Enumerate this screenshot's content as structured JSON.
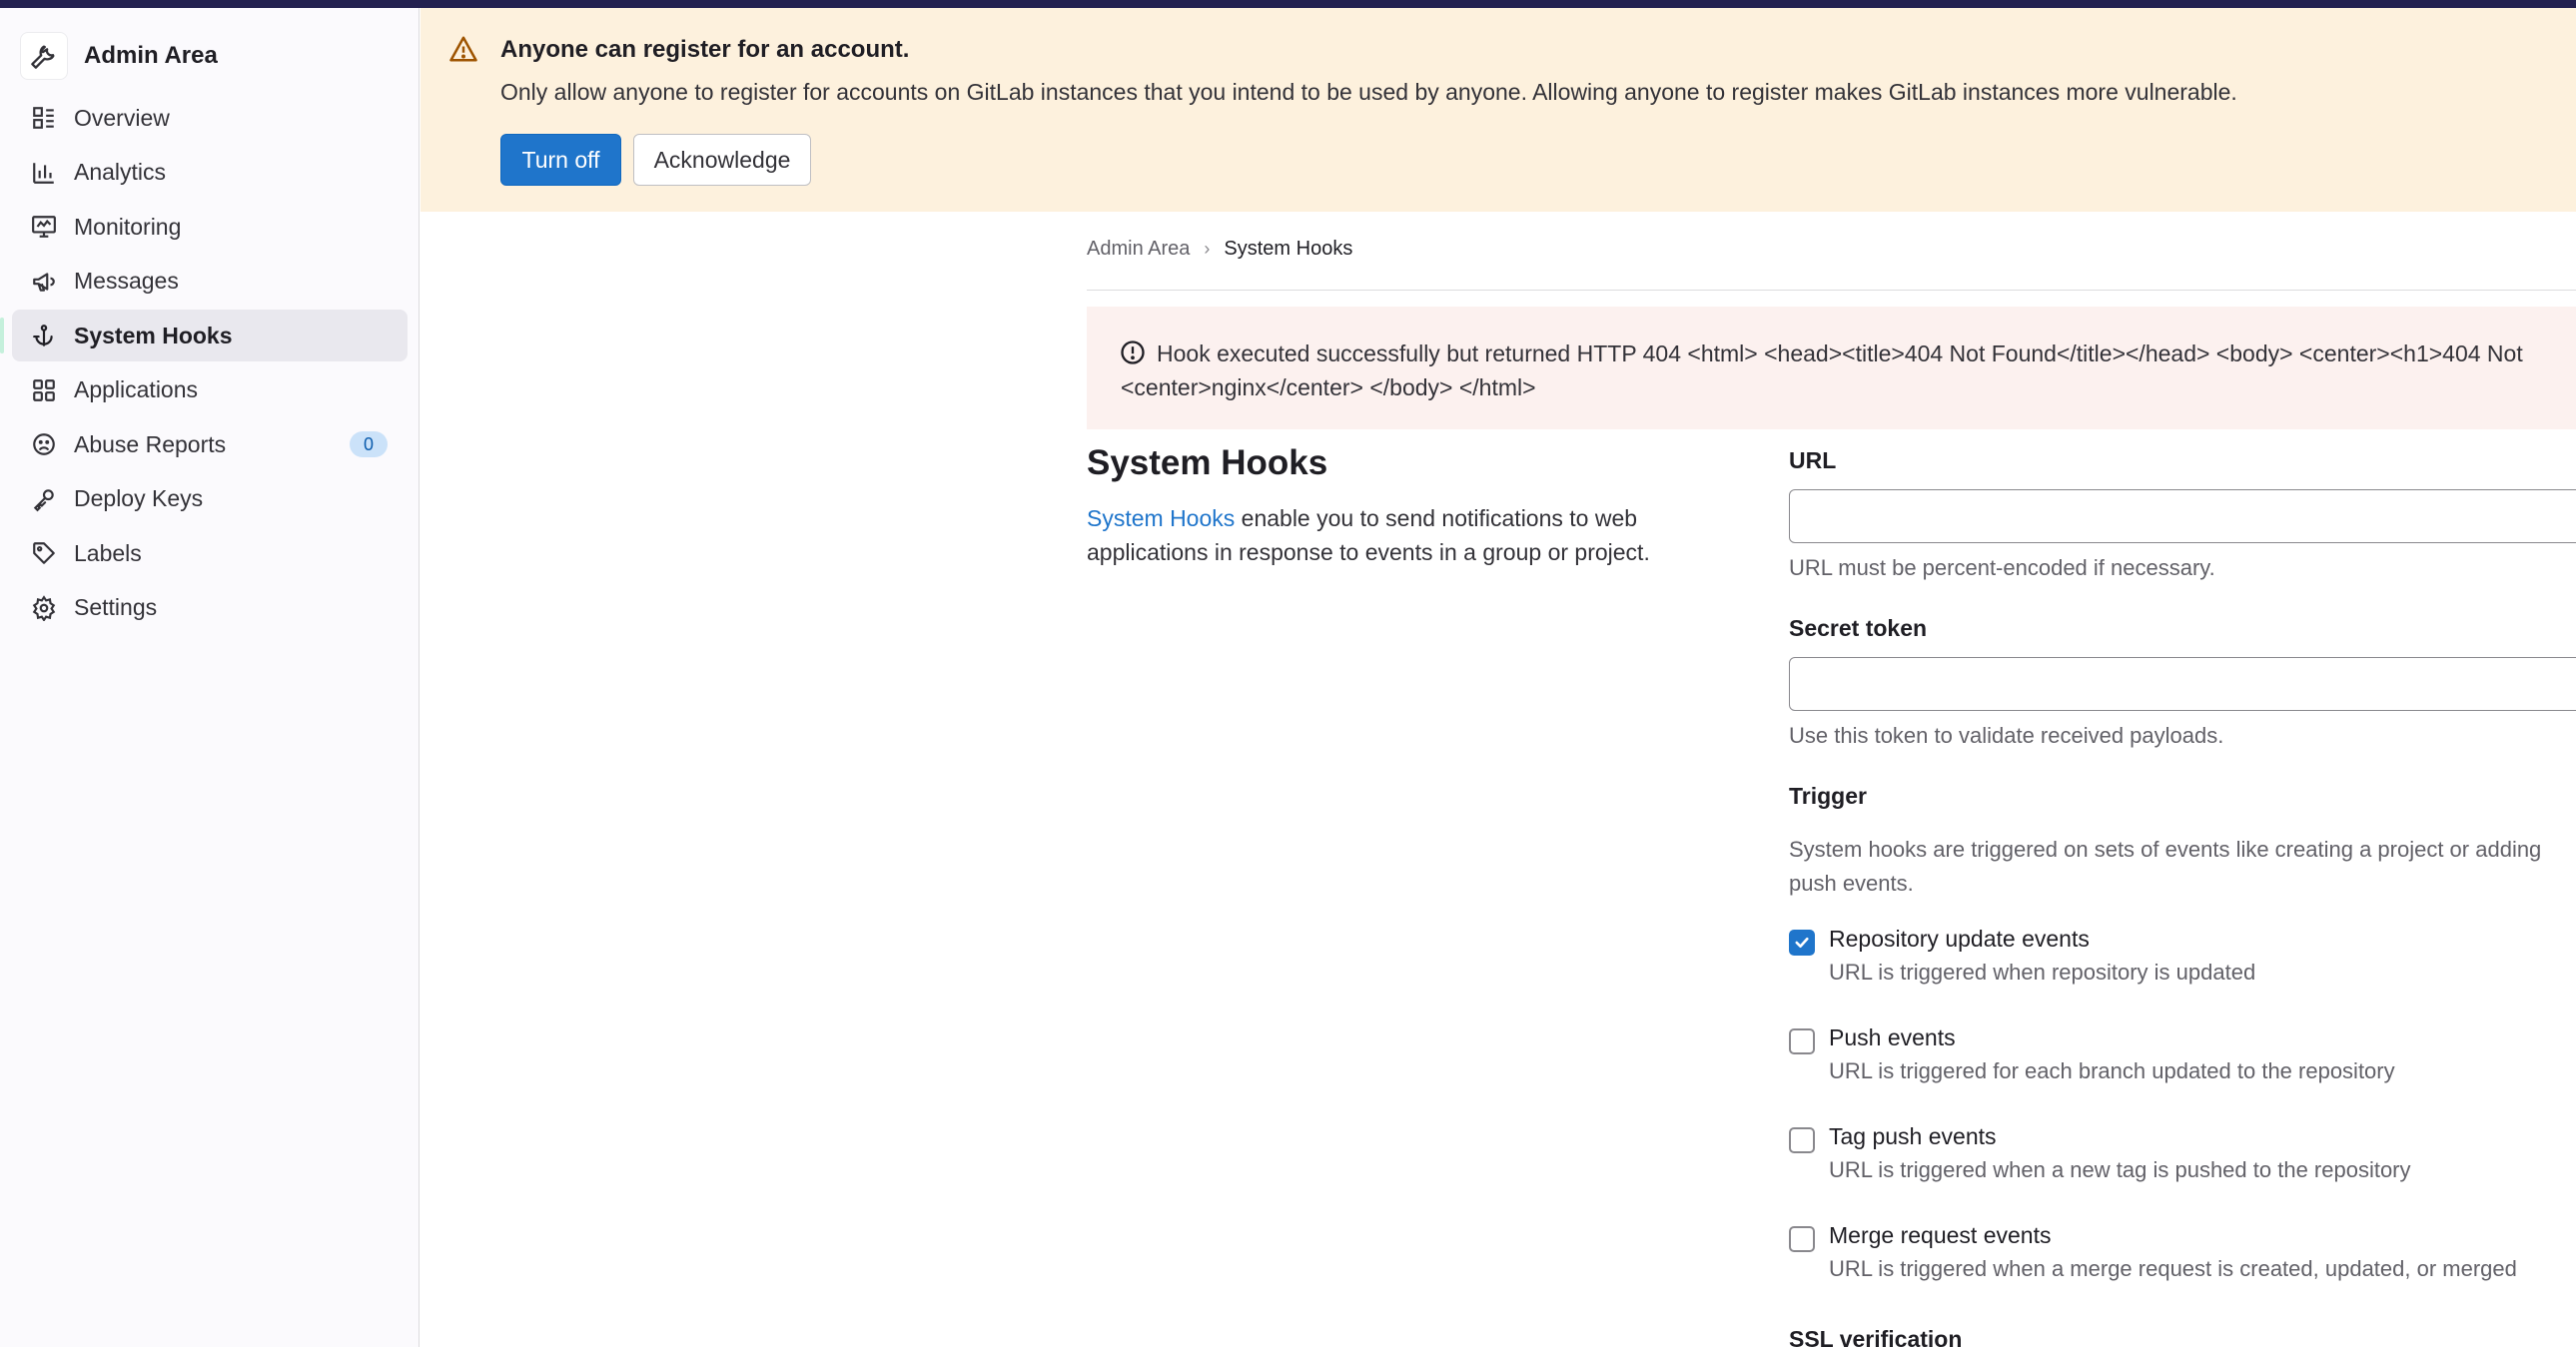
{
  "sidebar": {
    "title": "Admin Area",
    "items": [
      {
        "label": "Overview",
        "icon": "overview-icon"
      },
      {
        "label": "Analytics",
        "icon": "analytics-icon"
      },
      {
        "label": "Monitoring",
        "icon": "monitoring-icon"
      },
      {
        "label": "Messages",
        "icon": "bullhorn-icon"
      },
      {
        "label": "System Hooks",
        "icon": "hook-icon",
        "active": true
      },
      {
        "label": "Applications",
        "icon": "applications-icon"
      },
      {
        "label": "Abuse Reports",
        "icon": "abuse-icon",
        "badge": "0"
      },
      {
        "label": "Deploy Keys",
        "icon": "key-icon"
      },
      {
        "label": "Labels",
        "icon": "label-icon"
      },
      {
        "label": "Settings",
        "icon": "settings-icon"
      }
    ]
  },
  "banner": {
    "title": "Anyone can register for an account.",
    "text": "Only allow anyone to register for accounts on GitLab instances that you intend to be used by anyone. Allowing anyone to register makes GitLab instances more vulnerable.",
    "turn_off_label": "Turn off",
    "acknowledge_label": "Acknowledge"
  },
  "breadcrumb": {
    "root": "Admin Area",
    "current": "System Hooks"
  },
  "alert": {
    "line1": "Hook executed successfully but returned HTTP 404 <html> <head><title>404 Not Found</title></head> <body> <center><h1>404 Not",
    "line2": "<center>nginx</center> </body> </html>"
  },
  "section": {
    "title": "System Hooks",
    "link_text": "System Hooks",
    "description": " enable you to send notifications to web applications in response to events in a group or project."
  },
  "form": {
    "url_label": "URL",
    "url_value": "",
    "url_help": "URL must be percent-encoded if necessary.",
    "token_label": "Secret token",
    "token_value": "",
    "token_help": "Use this token to validate received payloads.",
    "trigger_label": "Trigger",
    "trigger_desc": "System hooks are triggered on sets of events like creating a project or adding",
    "trigger_desc2": "push events.",
    "triggers": [
      {
        "label": "Repository update events",
        "help": "URL is triggered when repository is updated",
        "checked": true
      },
      {
        "label": "Push events",
        "help": "URL is triggered for each branch updated to the repository",
        "checked": false
      },
      {
        "label": "Tag push events",
        "help": "URL is triggered when a new tag is pushed to the repository",
        "checked": false
      },
      {
        "label": "Merge request events",
        "help": "URL is triggered when a merge request is created, updated, or merged",
        "checked": false
      }
    ],
    "ssl_label": "SSL verification"
  },
  "colors": {
    "primary": "#1f75cb",
    "banner_bg": "#fdf1dd",
    "alert_bg": "#fcf1ef",
    "sidebar_bg": "#fbfafd",
    "badge_bg": "#cbe2f9"
  }
}
